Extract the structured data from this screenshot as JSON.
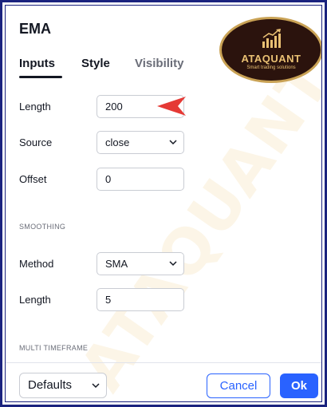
{
  "dialog": {
    "title": "EMA"
  },
  "brand": {
    "name": "ATAQUANT",
    "tagline": "Smart trading solutions",
    "watermark": "ATAQUANT"
  },
  "tabs": [
    {
      "label": "Inputs",
      "active": true
    },
    {
      "label": "Style",
      "active": false
    },
    {
      "label": "Visibility",
      "active": false
    }
  ],
  "inputs": {
    "length": {
      "label": "Length",
      "value": "200"
    },
    "source": {
      "label": "Source",
      "value": "close"
    },
    "offset": {
      "label": "Offset",
      "value": "0"
    }
  },
  "smoothing": {
    "section_label": "SMOOTHING",
    "method": {
      "label": "Method",
      "value": "SMA"
    },
    "length": {
      "label": "Length",
      "value": "5"
    }
  },
  "multi_timeframe": {
    "section_label": "MULTI TIMEFRAME"
  },
  "footer": {
    "defaults_label": "Defaults",
    "cancel_label": "Cancel",
    "ok_label": "Ok"
  },
  "colors": {
    "accent": "#2962ff",
    "annotation_arrow": "#e53935",
    "brand_gold": "#e9c073"
  },
  "icons": {
    "dropdown": "chevron-down-icon",
    "annotation": "arrow-pointer-icon"
  }
}
